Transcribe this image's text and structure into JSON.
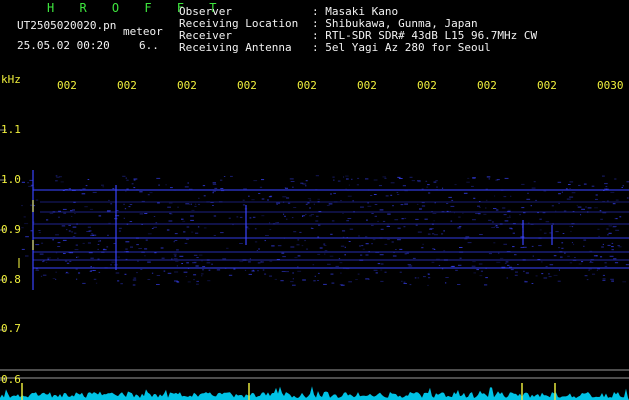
{
  "brand": "H R O F F T",
  "file": {
    "name": "UT2505020020.pn",
    "tag": "meteor",
    "datetime": "25.05.02 00:20",
    "count": "6.."
  },
  "header": {
    "observer_label": "Observer",
    "observer_value": ": Masaki Kano",
    "location_label": "Receiving Location",
    "location_value": ": Shibukawa, Gunma, Japan",
    "receiver_label": "Receiver",
    "receiver_value": ": RTL-SDR SDR# 43dB L15 96.7MHz CW",
    "antenna_label": "Receiving Antenna",
    "antenna_value": ": 5el Yagi Az 280 for Seoul"
  },
  "freq_axis": {
    "unit": "kHz",
    "labels": [
      "1.1",
      "1.0",
      "0.9",
      "0.8",
      "0.7",
      "0.6"
    ]
  },
  "time_axis": {
    "labels": [
      "002",
      "002",
      "002",
      "002",
      "002",
      "002",
      "002",
      "002",
      "002",
      "0030"
    ]
  },
  "colors": {
    "background": "#000000",
    "header_text": "#f2f2f2",
    "brand_text": "#3ee63e",
    "axis_text": "#f0f03c",
    "signal": "#3a44ff",
    "noise_floor": "#00d8ff"
  }
}
